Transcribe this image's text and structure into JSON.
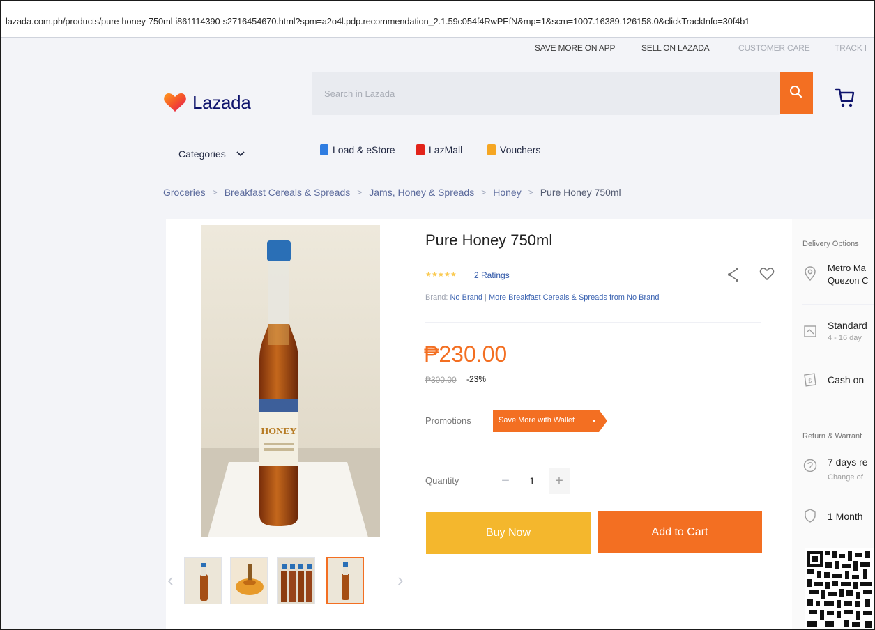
{
  "browser": {
    "url": "lazada.com.ph/products/pure-honey-750ml-i861114390-s2716454670.html?spm=a2o4l.pdp.recommendation_2.1.59c054f4RwPEfN&mp=1&scm=1007.16389.126158.0&clickTrackInfo=30f4b1"
  },
  "top_links": [
    "SAVE MORE ON APP",
    "SELL ON LAZADA",
    "CUSTOMER CARE",
    "TRACK I"
  ],
  "header": {
    "logo_text": "Lazada",
    "search_placeholder": "Search in Lazada",
    "brand_color": "#f36f22",
    "logo_color": "#0f146d"
  },
  "nav": {
    "categories_label": "Categories",
    "items": [
      {
        "label": "Load & eStore",
        "icon": "load-estore-icon",
        "color": "#2f7de1"
      },
      {
        "label": "LazMall",
        "icon": "lazmall-icon",
        "color": "#e2231a"
      },
      {
        "label": "Vouchers",
        "icon": "vouchers-icon",
        "color": "#f5a623"
      }
    ]
  },
  "breadcrumb": [
    "Groceries",
    "Breakfast Cereals & Spreads",
    "Jams, Honey & Spreads",
    "Honey",
    "Pure Honey 750ml"
  ],
  "product": {
    "title": "Pure Honey 750ml",
    "rating_stars": "★★★★★",
    "rating_value": 5,
    "ratings_text": "2 Ratings",
    "brand_label": "Brand:",
    "brand_name": "No Brand",
    "brand_more": "More Breakfast Cereals & Spreads from No Brand",
    "price": "₱230.00",
    "original_price": "₱300.00",
    "discount": "-23%",
    "promotions_label": "Promotions",
    "promo_tag": "Save More with Wallet",
    "quantity_label": "Quantity",
    "quantity_value": "1",
    "minus": "−",
    "plus": "+",
    "buy_now": "Buy Now",
    "add_to_cart": "Add to Cart"
  },
  "gallery": {
    "prev": "‹",
    "next": "›",
    "thumbnail_count": 4,
    "active_index": 3
  },
  "delivery": {
    "options_label": "Delivery Options",
    "location_line1": "Metro Ma",
    "location_line2": "Quezon C",
    "standard_label": "Standard",
    "standard_sub": "4 - 16 day",
    "cod_label": "Cash on",
    "return_label": "Return & Warrant",
    "return_main": "7 days re",
    "return_sub": "Change of",
    "warranty_main": "1 Month"
  }
}
